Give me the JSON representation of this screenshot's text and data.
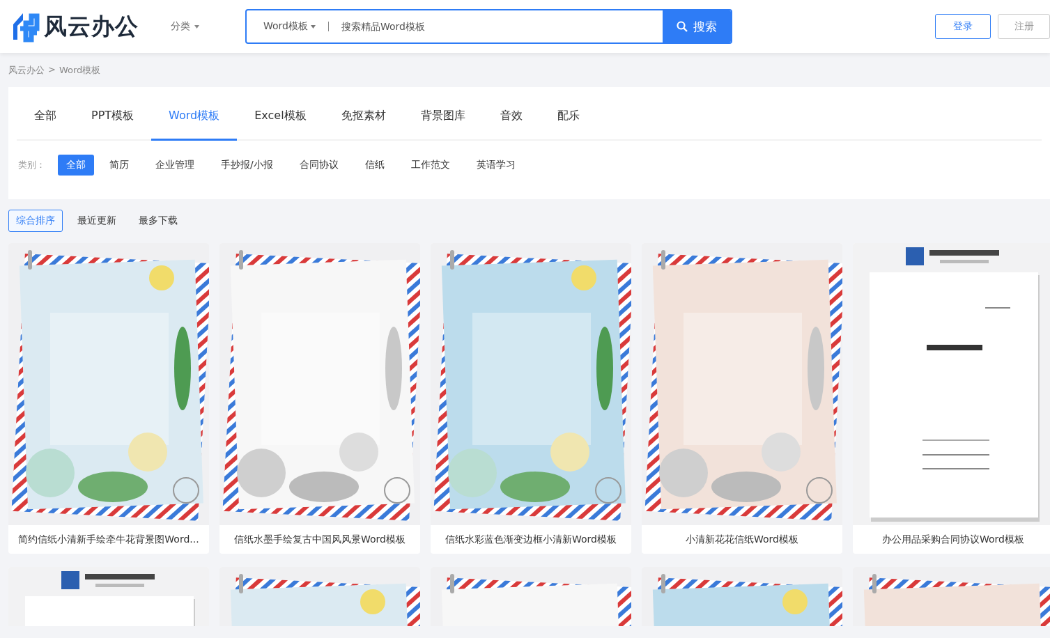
{
  "header": {
    "logo": "风云办公",
    "category_menu": "分类",
    "search": {
      "scope": "Word模板",
      "placeholder": "搜索精品Word模板",
      "button": "搜索"
    },
    "login": "登录",
    "register": "注册"
  },
  "breadcrumb": [
    "风云办公",
    ">",
    "Word模板"
  ],
  "tabs": [
    {
      "label": "全部",
      "selected": false
    },
    {
      "label": "PPT模板",
      "selected": false
    },
    {
      "label": "Word模板",
      "selected": true
    },
    {
      "label": "Excel模板",
      "selected": false
    },
    {
      "label": "免抠素材",
      "selected": false
    },
    {
      "label": "背景图库",
      "selected": false
    },
    {
      "label": "音效",
      "selected": false
    },
    {
      "label": "配乐",
      "selected": false
    }
  ],
  "filter": {
    "label": "类别：",
    "options": [
      {
        "label": "全部",
        "selected": true
      },
      {
        "label": "简历",
        "selected": false
      },
      {
        "label": "企业管理",
        "selected": false
      },
      {
        "label": "手抄报/小报",
        "selected": false
      },
      {
        "label": "合同协议",
        "selected": false
      },
      {
        "label": "信纸",
        "selected": false
      },
      {
        "label": "工作范文",
        "selected": false
      },
      {
        "label": "英语学习",
        "selected": false
      }
    ]
  },
  "sort": [
    {
      "label": "综合排序",
      "selected": true
    },
    {
      "label": "最近更新",
      "selected": false
    },
    {
      "label": "最多下载",
      "selected": false
    }
  ],
  "cards": [
    {
      "kind": "letter",
      "title": "简约信纸小清新手绘牵牛花背景图Word..."
    },
    {
      "kind": "letter",
      "title": "信纸水墨手绘复古中国风风景Word模板"
    },
    {
      "kind": "letter",
      "title": "信纸水彩蓝色渐变边框小清新Word模板"
    },
    {
      "kind": "letter",
      "title": "小清新花花信纸Word模板"
    },
    {
      "kind": "document",
      "title": "办公用品采购合同协议Word模板"
    },
    {
      "kind": "document"
    },
    {
      "kind": "letter"
    },
    {
      "kind": "letter"
    },
    {
      "kind": "letter"
    },
    {
      "kind": "letter"
    }
  ]
}
